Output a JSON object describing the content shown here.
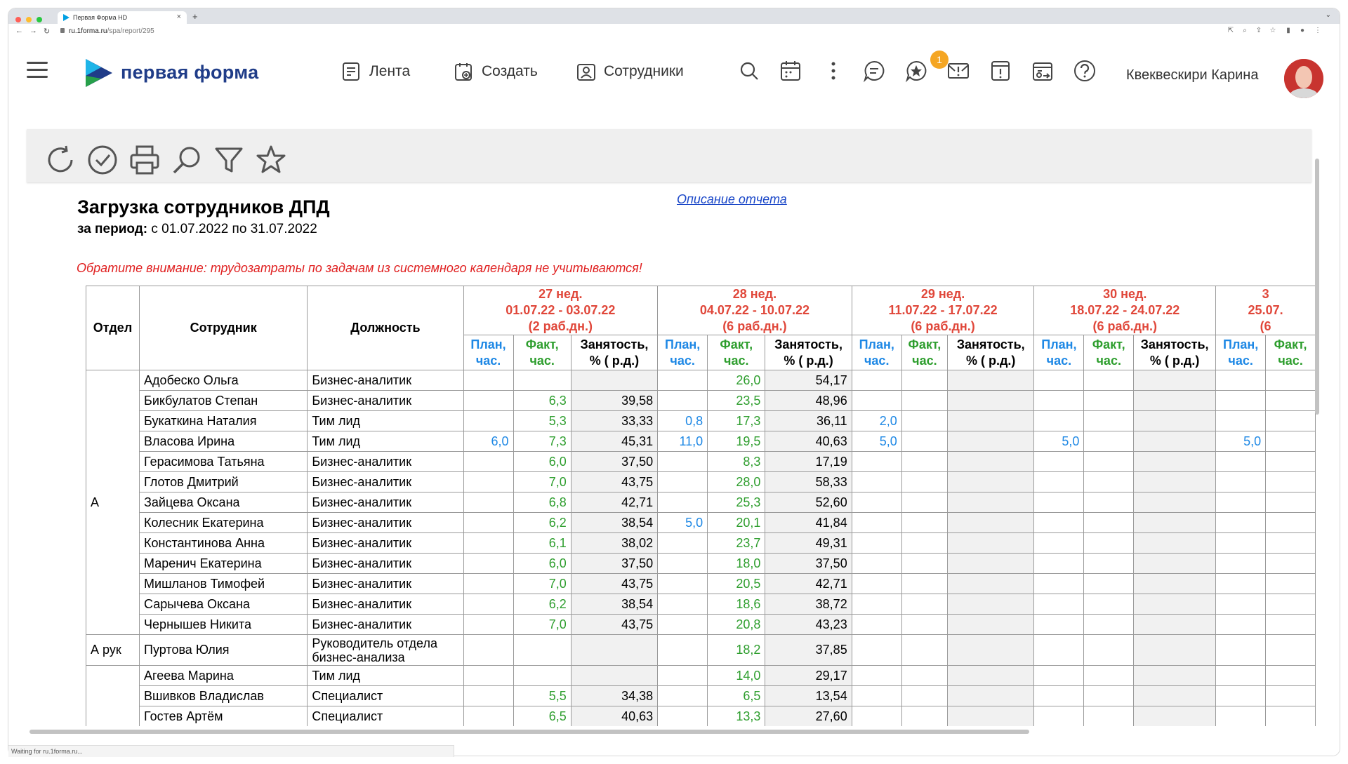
{
  "browser": {
    "tab_title": "Первая Форма HD",
    "url_host": "ru.1forma.ru",
    "url_path": "/spa/report/295",
    "status": "Waiting for ru.1forma.ru..."
  },
  "header": {
    "logo_text": "первая форма",
    "nav": [
      {
        "label": "Лента",
        "icon": "feed-icon"
      },
      {
        "label": "Создать",
        "icon": "create-icon"
      },
      {
        "label": "Сотрудники",
        "icon": "employees-icon"
      }
    ],
    "badge_count": "1",
    "user_name": "Квеквескири Карина"
  },
  "report": {
    "title": "Загрузка сотрудников ДПД",
    "period_label": "за период:",
    "period_value": " с 01.07.2022 по 31.07.2022",
    "description_link": "Описание отчета",
    "warning": "Обратите внимание: трудозатраты по задачам из системного календаря не учитываются!",
    "columns": {
      "dept": "Отдел",
      "employee": "Сотрудник",
      "position": "Должность",
      "plan": [
        "План,",
        "час."
      ],
      "fact": [
        "Факт,",
        "час."
      ],
      "occupancy": [
        "Занятость,",
        "% ( р.д.)"
      ]
    },
    "weeks": [
      {
        "name": "27 нед.",
        "range": "01.07.22 - 03.07.22",
        "days": "(2 раб.дн.)"
      },
      {
        "name": "28 нед.",
        "range": "04.07.22 - 10.07.22",
        "days": "(6 раб.дн.)"
      },
      {
        "name": "29 нед.",
        "range": "11.07.22 - 17.07.22",
        "days": "(6 раб.дн.)"
      },
      {
        "name": "30 нед.",
        "range": "18.07.22 - 24.07.22",
        "days": "(6 раб.дн.)"
      },
      {
        "name": "3",
        "range": "25.07.",
        "days": "(6"
      }
    ],
    "groups": [
      {
        "dept": "А",
        "rows": [
          {
            "employee": "Адобеско Ольга",
            "position": "Бизнес-аналитик",
            "w": [
              [
                "",
                "",
                ""
              ],
              [
                "",
                "26,0",
                "54,17"
              ],
              [
                "",
                "",
                ""
              ],
              [
                "",
                "",
                ""
              ],
              [
                "",
                "",
                ""
              ]
            ]
          },
          {
            "employee": "Бикбулатов Степан",
            "position": "Бизнес-аналитик",
            "w": [
              [
                "",
                "6,3",
                "39,58"
              ],
              [
                "",
                "23,5",
                "48,96"
              ],
              [
                "",
                "",
                ""
              ],
              [
                "",
                "",
                ""
              ],
              [
                "",
                "",
                ""
              ]
            ]
          },
          {
            "employee": "Букаткина Наталия",
            "position": "Тим лид",
            "w": [
              [
                "",
                "5,3",
                "33,33"
              ],
              [
                "0,8",
                "17,3",
                "36,11"
              ],
              [
                "2,0",
                "",
                ""
              ],
              [
                "",
                "",
                ""
              ],
              [
                "",
                "",
                ""
              ]
            ]
          },
          {
            "employee": "Власова Ирина",
            "position": "Тим лид",
            "w": [
              [
                "6,0",
                "7,3",
                "45,31"
              ],
              [
                "11,0",
                "19,5",
                "40,63"
              ],
              [
                "5,0",
                "",
                ""
              ],
              [
                "5,0",
                "",
                ""
              ],
              [
                "5,0",
                "",
                ""
              ]
            ]
          },
          {
            "employee": "Герасимова Татьяна",
            "position": "Бизнес-аналитик",
            "w": [
              [
                "",
                "6,0",
                "37,50"
              ],
              [
                "",
                "8,3",
                "17,19"
              ],
              [
                "",
                "",
                ""
              ],
              [
                "",
                "",
                ""
              ],
              [
                "",
                "",
                ""
              ]
            ]
          },
          {
            "employee": "Глотов Дмитрий",
            "position": "Бизнес-аналитик",
            "w": [
              [
                "",
                "7,0",
                "43,75"
              ],
              [
                "",
                "28,0",
                "58,33"
              ],
              [
                "",
                "",
                ""
              ],
              [
                "",
                "",
                ""
              ],
              [
                "",
                "",
                ""
              ]
            ]
          },
          {
            "employee": "Зайцева Оксана",
            "position": "Бизнес-аналитик",
            "w": [
              [
                "",
                "6,8",
                "42,71"
              ],
              [
                "",
                "25,3",
                "52,60"
              ],
              [
                "",
                "",
                ""
              ],
              [
                "",
                "",
                ""
              ],
              [
                "",
                "",
                ""
              ]
            ]
          },
          {
            "employee": "Колесник Екатерина",
            "position": "Бизнес-аналитик",
            "w": [
              [
                "",
                "6,2",
                "38,54"
              ],
              [
                "5,0",
                "20,1",
                "41,84"
              ],
              [
                "",
                "",
                ""
              ],
              [
                "",
                "",
                ""
              ],
              [
                "",
                "",
                ""
              ]
            ]
          },
          {
            "employee": "Константинова Анна",
            "position": "Бизнес-аналитик",
            "w": [
              [
                "",
                "6,1",
                "38,02"
              ],
              [
                "",
                "23,7",
                "49,31"
              ],
              [
                "",
                "",
                ""
              ],
              [
                "",
                "",
                ""
              ],
              [
                "",
                "",
                ""
              ]
            ]
          },
          {
            "employee": "Маренич Екатерина",
            "position": "Бизнес-аналитик",
            "w": [
              [
                "",
                "6,0",
                "37,50"
              ],
              [
                "",
                "18,0",
                "37,50"
              ],
              [
                "",
                "",
                ""
              ],
              [
                "",
                "",
                ""
              ],
              [
                "",
                "",
                ""
              ]
            ]
          },
          {
            "employee": "Мишланов Тимофей",
            "position": "Бизнес-аналитик",
            "w": [
              [
                "",
                "7,0",
                "43,75"
              ],
              [
                "",
                "20,5",
                "42,71"
              ],
              [
                "",
                "",
                ""
              ],
              [
                "",
                "",
                ""
              ],
              [
                "",
                "",
                ""
              ]
            ]
          },
          {
            "employee": "Сарычева Оксана",
            "position": "Бизнес-аналитик",
            "w": [
              [
                "",
                "6,2",
                "38,54"
              ],
              [
                "",
                "18,6",
                "38,72"
              ],
              [
                "",
                "",
                ""
              ],
              [
                "",
                "",
                ""
              ],
              [
                "",
                "",
                ""
              ]
            ]
          },
          {
            "employee": "Чернышев Никита",
            "position": "Бизнес-аналитик",
            "w": [
              [
                "",
                "7,0",
                "43,75"
              ],
              [
                "",
                "20,8",
                "43,23"
              ],
              [
                "",
                "",
                ""
              ],
              [
                "",
                "",
                ""
              ],
              [
                "",
                "",
                ""
              ]
            ]
          }
        ]
      },
      {
        "dept": "А рук",
        "rows": [
          {
            "employee": "Пуртова Юлия",
            "position": [
              "Руководитель отдела",
              "бизнес-анализа"
            ],
            "w": [
              [
                "",
                "",
                ""
              ],
              [
                "",
                "18,2",
                "37,85"
              ],
              [
                "",
                "",
                ""
              ],
              [
                "",
                "",
                ""
              ],
              [
                "",
                "",
                ""
              ]
            ]
          }
        ]
      },
      {
        "dept": "",
        "rows": [
          {
            "employee": "Агеева Марина",
            "position": "Тим лид",
            "w": [
              [
                "",
                "",
                ""
              ],
              [
                "",
                "14,0",
                "29,17"
              ],
              [
                "",
                "",
                ""
              ],
              [
                "",
                "",
                ""
              ],
              [
                "",
                "",
                ""
              ]
            ]
          },
          {
            "employee": "Вшивков Владислав",
            "position": "Специалист",
            "w": [
              [
                "",
                "5,5",
                "34,38"
              ],
              [
                "",
                "6,5",
                "13,54"
              ],
              [
                "",
                "",
                ""
              ],
              [
                "",
                "",
                ""
              ],
              [
                "",
                "",
                ""
              ]
            ]
          },
          {
            "employee": "Гостев Артём",
            "position": "Специалист",
            "w": [
              [
                "",
                "6,5",
                "40,63"
              ],
              [
                "",
                "13,3",
                "27,60"
              ],
              [
                "",
                "",
                ""
              ],
              [
                "",
                "",
                ""
              ],
              [
                "",
                "",
                ""
              ]
            ]
          }
        ]
      }
    ]
  },
  "colors": {
    "brand": "#1f3c88",
    "week_header": "#e0473a",
    "plan": "#1e88e5",
    "fact": "#2e9e2e",
    "warning": "#e02020"
  }
}
